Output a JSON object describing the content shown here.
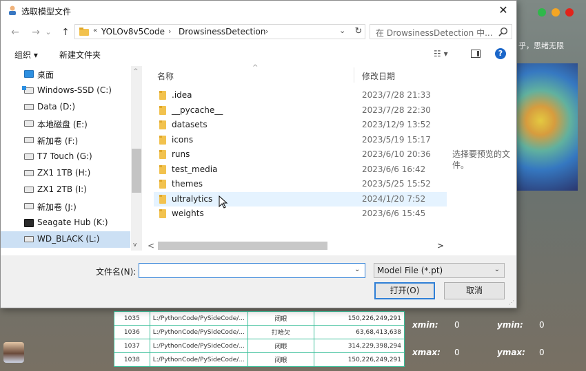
{
  "dialog": {
    "title": "选取模型文件",
    "close_glyph": "✕",
    "nav": {
      "back": "←",
      "forward": "→",
      "dropdown": "⌄",
      "up": "↑"
    },
    "address": {
      "more": "«",
      "crumbs": [
        "YOLOv8v5Code",
        "DrowsinessDetection"
      ],
      "sep": "›",
      "dropdown": "⌄",
      "refresh": "↻"
    },
    "search_placeholder": "在 DrowsinessDetection 中...",
    "toolbar": {
      "organize": "组织 ▾",
      "new_folder": "新建文件夹",
      "view": "☷ ▾",
      "help": "?"
    },
    "sidebar": [
      {
        "label": "桌面",
        "kind": "desk"
      },
      {
        "label": "Windows-SSD (C:)",
        "kind": "win"
      },
      {
        "label": "Data (D:)",
        "kind": "drive"
      },
      {
        "label": "本地磁盘 (E:)",
        "kind": "drive"
      },
      {
        "label": "新加卷 (F:)",
        "kind": "drive"
      },
      {
        "label": "T7 Touch (G:)",
        "kind": "drive"
      },
      {
        "label": "ZX1 1TB (H:)",
        "kind": "drive"
      },
      {
        "label": "ZX1 2TB (I:)",
        "kind": "drive"
      },
      {
        "label": "新加卷 (J:)",
        "kind": "drive"
      },
      {
        "label": "Seagate Hub (K:)",
        "kind": "hub"
      },
      {
        "label": "WD_BLACK (L:)",
        "kind": "drive",
        "selected": true
      }
    ],
    "scroll_glyphs": {
      "up": "^",
      "down": "v",
      "left": "<",
      "right": ">"
    },
    "columns": {
      "name": "名称",
      "date": "修改日期",
      "sort_glyph": "^"
    },
    "files": [
      {
        "name": ".idea",
        "date": "2023/7/28 21:33"
      },
      {
        "name": "__pycache__",
        "date": "2023/7/28 22:30"
      },
      {
        "name": "datasets",
        "date": "2023/12/9 13:52"
      },
      {
        "name": "icons",
        "date": "2023/5/19 15:17"
      },
      {
        "name": "runs",
        "date": "2023/6/10 20:36"
      },
      {
        "name": "test_media",
        "date": "2023/6/6 16:42"
      },
      {
        "name": "themes",
        "date": "2023/5/25 15:52"
      },
      {
        "name": "ultralytics",
        "date": "2024/1/20 7:52",
        "hover": true
      },
      {
        "name": "weights",
        "date": "2023/6/6 15:45"
      }
    ],
    "preview_text": "选择要预览的文件。",
    "filename_label": "文件名(N):",
    "filename_value": "",
    "filetype": "Model File (*.pt)",
    "select_glyph": "⌄",
    "open_button": "打开(O)",
    "cancel_button": "取消",
    "grip": "⋰"
  },
  "background": {
    "traffic_colors": [
      "#2fb84a",
      "#f5a623",
      "#e2231a"
    ],
    "hint_text": "乎，思绪无限",
    "table_rows": [
      [
        "1035",
        "L:/PythonCode/PySideCode/...",
        "闭眼",
        "150,226,249,291"
      ],
      [
        "1036",
        "L:/PythonCode/PySideCode/...",
        "打哈欠",
        "63,68,413,638"
      ],
      [
        "1037",
        "L:/PythonCode/PySideCode/...",
        "闭眼",
        "314,229,398,294"
      ],
      [
        "1038",
        "L:/PythonCode/PySideCode/...",
        "闭眼",
        "150,226,249,291"
      ]
    ],
    "coords": {
      "xmin_label": "xmin:",
      "xmin": "0",
      "ymin_label": "ymin:",
      "ymin": "0",
      "xmax_label": "xmax:",
      "xmax": "0",
      "ymax_label": "ymax:",
      "ymax": "0"
    }
  },
  "colors": {
    "accent": "#2f7fd6",
    "selection": "#cce0f4",
    "hover": "#e5f3ff",
    "folder": "#f2c24e",
    "table_border": "#3bbf9a"
  }
}
